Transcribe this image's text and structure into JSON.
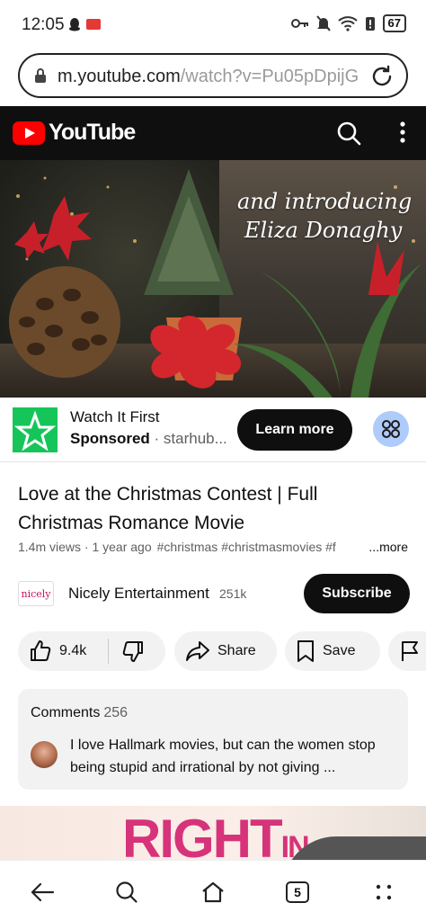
{
  "status_bar": {
    "time": "12:05",
    "battery": "67"
  },
  "browser": {
    "url_host": "m.youtube.com",
    "url_path": "/watch?v=Pu05pDpijG",
    "tab_count": "5"
  },
  "youtube": {
    "logo_text": "YouTube"
  },
  "video": {
    "overlay_line1": "and introducing",
    "overlay_line2": "Eliza Donaghy"
  },
  "ad": {
    "title": "Watch It First",
    "sponsored": "Sponsored",
    "advertiser": " · starhub...",
    "learn_more": "Learn more"
  },
  "details": {
    "title": "Love at the Christmas Contest | Full Christmas Romance Movie",
    "meta": "1.4m views · 1 year ago",
    "tags": "#christmas #christmasmovies #f",
    "more": "...more"
  },
  "channel": {
    "avatar_text": "nicely",
    "name": "Nicely Entertainment",
    "subscribers": "251k",
    "subscribe_label": "Subscribe"
  },
  "actions": {
    "likes": "9.4k",
    "share": "Share",
    "save": "Save"
  },
  "comments": {
    "label": "Comments",
    "count": "256",
    "top_comment": "I love Hallmark movies, but can the women stop being stupid and irrational by not giving ..."
  },
  "next_strip": {
    "word": "RIGHT",
    "suffix": "IN"
  },
  "colors": {
    "youtube_red": "#ff0000",
    "header_bg": "#0f0f0f",
    "ad_logo_green": "#16c559",
    "ad_info_blue": "#aecbfa",
    "pill_gray": "#f2f2f2"
  }
}
